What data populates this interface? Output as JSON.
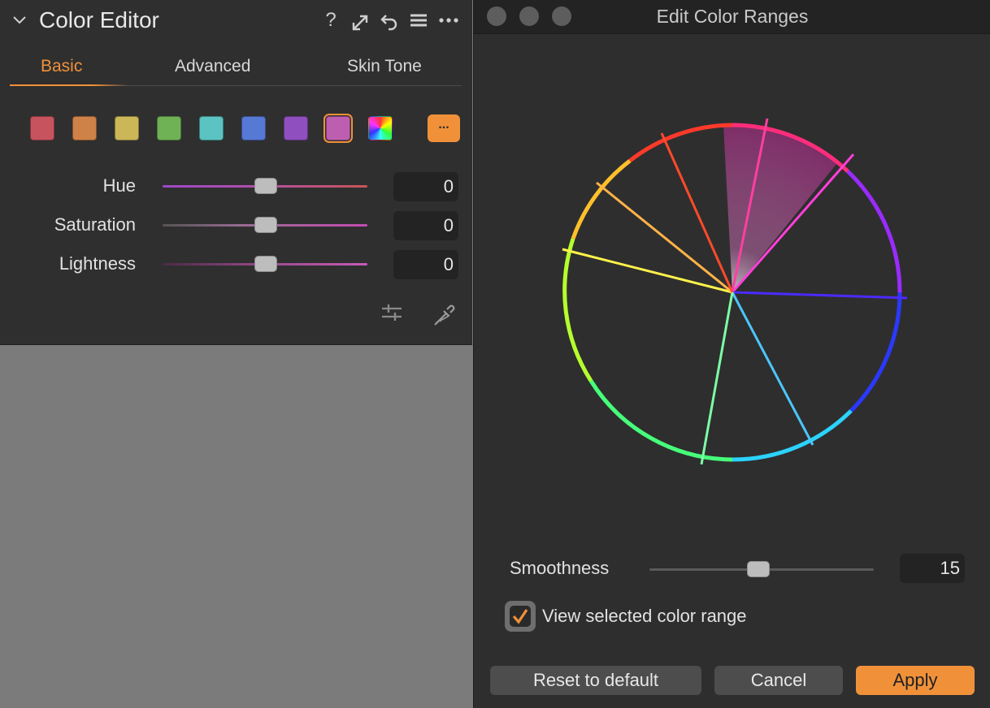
{
  "panel": {
    "title": "Color Editor",
    "header_icons": [
      "question-icon",
      "expand-icon",
      "undo-icon",
      "menu-icon",
      "more-icon"
    ],
    "tabs": [
      {
        "label": "Basic",
        "active": true
      },
      {
        "label": "Advanced",
        "active": false
      },
      {
        "label": "Skin Tone",
        "active": false
      }
    ],
    "swatches": [
      {
        "name": "red",
        "color": "#c7535e"
      },
      {
        "name": "orange",
        "color": "#cf8247"
      },
      {
        "name": "yellow",
        "color": "#cbb658"
      },
      {
        "name": "green",
        "color": "#6fb255"
      },
      {
        "name": "cyan",
        "color": "#5bc3c2"
      },
      {
        "name": "blue",
        "color": "#5679d6"
      },
      {
        "name": "purple",
        "color": "#8f4fbf"
      },
      {
        "name": "magenta",
        "color": "#bd5fb0",
        "selected": true
      },
      {
        "name": "all",
        "color": "multi"
      }
    ],
    "more_label": "...",
    "sliders": [
      {
        "label": "Hue",
        "value": "0",
        "track": "linear-gradient(90deg,#9b49c9,#b34fa5 50%,#c95456)"
      },
      {
        "label": "Saturation",
        "value": "0",
        "track": "linear-gradient(90deg,#555,#9b6b94 40%,#c44bb1)"
      },
      {
        "label": "Lightness",
        "value": "0",
        "track": "linear-gradient(90deg,#4b2a45,#9a4a8c 50%,#c85ab8)"
      }
    ],
    "accent": "#f0913a"
  },
  "dialog": {
    "title": "Edit Color Ranges",
    "smoothness_label": "Smoothness",
    "smoothness_value": "15",
    "checkbox_label": "View selected color range",
    "checkbox_checked": true,
    "buttons": {
      "reset": "Reset to default",
      "cancel": "Cancel",
      "apply": "Apply"
    }
  }
}
